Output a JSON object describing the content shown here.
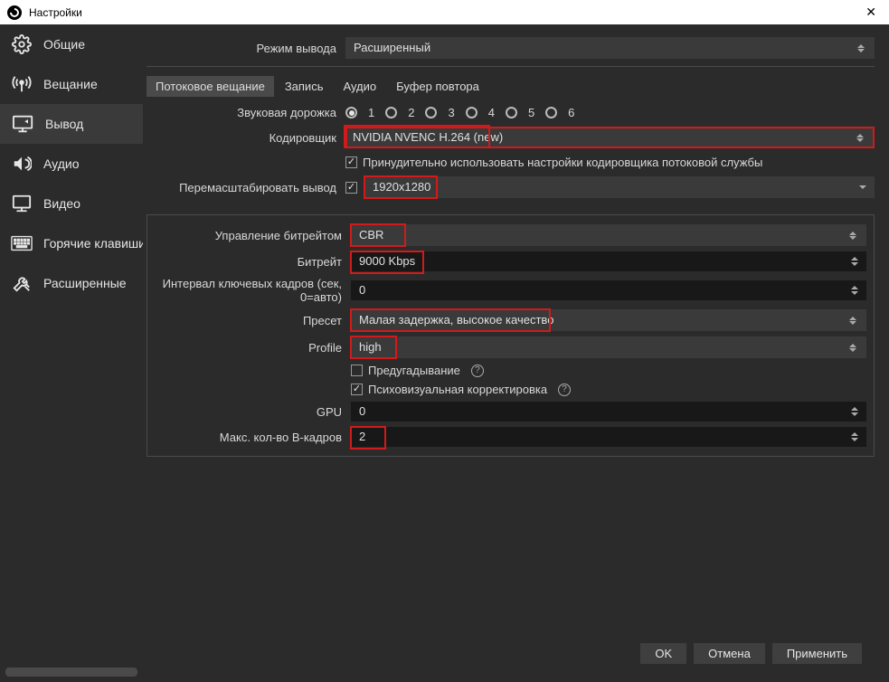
{
  "window": {
    "title": "Настройки"
  },
  "sidebar": {
    "items": [
      {
        "label": "Общие"
      },
      {
        "label": "Вещание"
      },
      {
        "label": "Вывод"
      },
      {
        "label": "Аудио"
      },
      {
        "label": "Видео"
      },
      {
        "label": "Горячие клавиши"
      },
      {
        "label": "Расширенные"
      }
    ]
  },
  "content": {
    "output_mode_label": "Режим вывода",
    "output_mode_value": "Расширенный",
    "tabs": [
      {
        "label": "Потоковое вещание"
      },
      {
        "label": "Запись"
      },
      {
        "label": "Аудио"
      },
      {
        "label": "Буфер повтора"
      }
    ],
    "audio_track_label": "Звуковая дорожка",
    "audio_tracks": [
      "1",
      "2",
      "3",
      "4",
      "5",
      "6"
    ],
    "encoder_label": "Кодировщик",
    "encoder_value": "NVIDIA NVENC H.264 (new)",
    "enforce_label": "Принудительно использовать настройки кодировщика потоковой службы",
    "rescale_label": "Перемасштабировать вывод",
    "rescale_value": "1920x1280",
    "rate_control_label": "Управление битрейтом",
    "rate_control_value": "CBR",
    "bitrate_label": "Битрейт",
    "bitrate_value": "9000 Kbps",
    "keyint_label": "Интервал ключевых кадров (сек, 0=авто)",
    "keyint_value": "0",
    "preset_label": "Пресет",
    "preset_value": "Малая задержка, высокое качество",
    "profile_label": "Profile",
    "profile_value": "high",
    "lookahead_label": "Предугадывание",
    "psycho_label": "Психовизуальная корректировка",
    "gpu_label": "GPU",
    "gpu_value": "0",
    "bframes_label": "Макс. кол-во B-кадров",
    "bframes_value": "2"
  },
  "footer": {
    "ok": "OK",
    "cancel": "Отмена",
    "apply": "Применить"
  }
}
